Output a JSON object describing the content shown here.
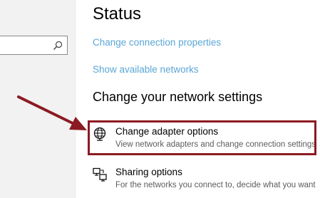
{
  "header": {
    "title": "Status"
  },
  "links": {
    "change_connection_properties": "Change connection properties",
    "show_available_networks": "Show available networks"
  },
  "section": {
    "heading": "Change your network settings"
  },
  "options": [
    {
      "title": "Change adapter options",
      "description": "View network adapters and change connection settings",
      "icon": "globe-network-icon",
      "highlighted": true
    },
    {
      "title": "Sharing options",
      "description": "For the networks you connect to, decide what you want",
      "icon": "sharing-icon",
      "highlighted": false
    }
  ],
  "search": {
    "value": "",
    "icon": "search-icon"
  },
  "colors": {
    "link": "#5aa6d6",
    "annotation": "#8b1a22",
    "nav_background": "#f2f2f2"
  }
}
